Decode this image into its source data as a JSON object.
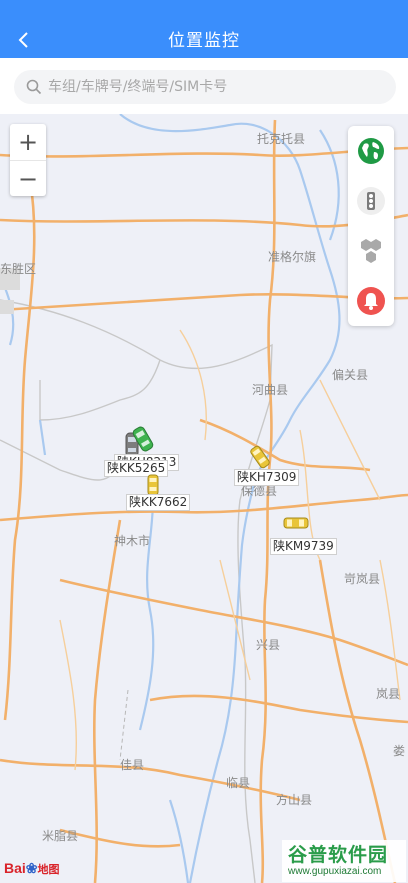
{
  "header": {
    "title": "位置监控",
    "back_icon": "chevron-left-icon"
  },
  "search": {
    "placeholder": "车组/车牌号/终端号/SIM卡号",
    "value": ""
  },
  "zoom": {
    "in_label": "+",
    "out_label": "−"
  },
  "toolbar": [
    {
      "name": "map-type-button",
      "icon": "globe-icon"
    },
    {
      "name": "traffic-button",
      "icon": "traffic-light-icon"
    },
    {
      "name": "cluster-button",
      "icon": "hexagon-cluster-icon"
    },
    {
      "name": "alarm-button",
      "icon": "bell-icon"
    }
  ],
  "map": {
    "place_labels": [
      "托克托县",
      "东胜区",
      "准格尔旗",
      "偏关县",
      "河曲县",
      "保德县",
      "神木市",
      "岢岚县",
      "兴县",
      "岚县",
      "佳县",
      "临县",
      "方山县",
      "米脂县",
      "娄"
    ],
    "vehicles": [
      {
        "plate": "陕KK5265",
        "color": "gray"
      },
      {
        "plate": "陕KH8213",
        "color": "green"
      },
      {
        "plate": "陕KK7662",
        "color": "yellow"
      },
      {
        "plate": "陕KH7309",
        "color": "yellow"
      },
      {
        "plate": "陕KM9739",
        "color": "yellow"
      }
    ]
  },
  "attribution": {
    "logo_text": "Bai",
    "logo_text2": "地图"
  },
  "watermark": {
    "title": "谷普软件园",
    "url": "www.gupuxiazai.com"
  },
  "colors": {
    "header": "#3a8efc",
    "road_major": "#f2b06a",
    "river": "#a9c9ef",
    "border": "#c8c8c8"
  }
}
